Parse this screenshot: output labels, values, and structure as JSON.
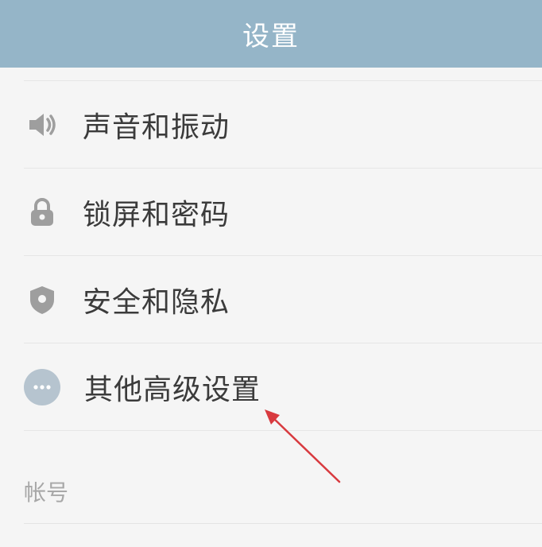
{
  "header": {
    "title": "设置"
  },
  "items": [
    {
      "label": "声音和振动",
      "icon": "speaker-vibration-icon"
    },
    {
      "label": "锁屏和密码",
      "icon": "lock-icon"
    },
    {
      "label": "安全和隐私",
      "icon": "shield-icon"
    },
    {
      "label": "其他高级设置",
      "icon": "more-dots-icon"
    }
  ],
  "section": {
    "account_label": "帐号"
  },
  "colors": {
    "header_bg": "#95b5c8",
    "icon_gray": "#9e9e9e",
    "more_icon_bg": "#b6c4cf",
    "annotation_arrow": "#d83a3f"
  }
}
